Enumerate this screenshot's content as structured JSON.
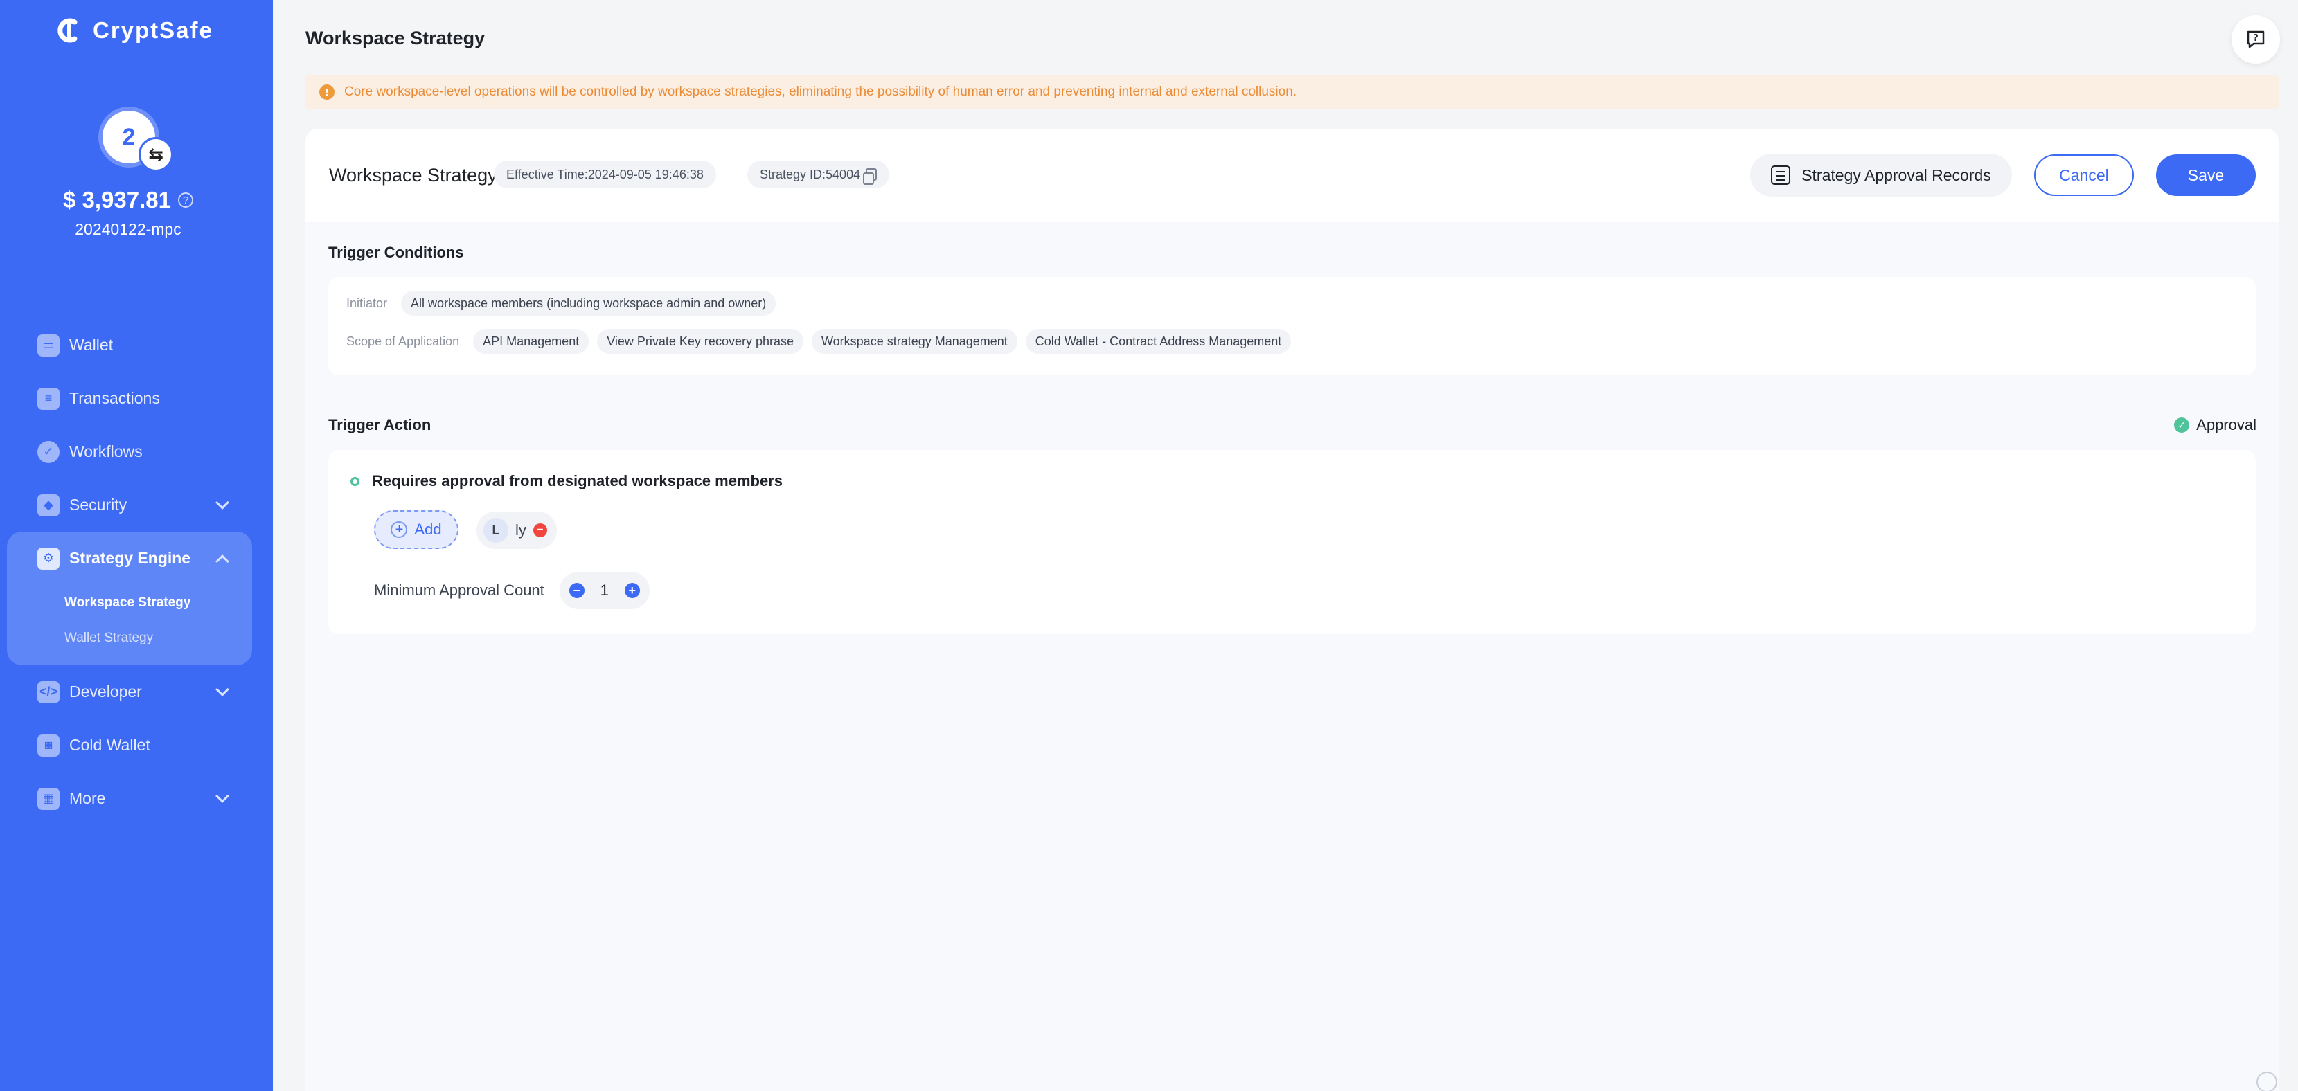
{
  "app": {
    "name": "CryptSafe"
  },
  "account": {
    "avatar_number": "2",
    "switch_glyph": "⇆",
    "balance": "$ 3,937.81",
    "wallet_name": "20240122-mpc"
  },
  "nav": {
    "wallet": "Wallet",
    "transactions": "Transactions",
    "workflows": "Workflows",
    "security": "Security",
    "strategy_engine": "Strategy Engine",
    "workspace_strategy": "Workspace Strategy",
    "wallet_strategy": "Wallet Strategy",
    "developer": "Developer",
    "cold_wallet": "Cold Wallet",
    "more": "More"
  },
  "header": {
    "title": "Workspace Strategy"
  },
  "notice": {
    "icon": "!",
    "text": "Core workspace-level operations will be controlled by workspace strategies, eliminating the possibility of human error and preventing internal and external collusion."
  },
  "strategy": {
    "title": "Workspace Strategy",
    "effective_time": "Effective Time:2024-09-05 19:46:38",
    "strategy_id": "Strategy ID:54004",
    "records_label": "Strategy Approval Records",
    "cancel_label": "Cancel",
    "save_label": "Save"
  },
  "trigger_conditions": {
    "title": "Trigger Conditions",
    "initiator_label": "Initiator",
    "initiator_value": "All workspace members (including workspace admin and owner)",
    "scope_label": "Scope of Application",
    "scope_items": [
      "API Management",
      "View Private Key recovery phrase",
      "Workspace strategy Management",
      "Cold Wallet - Contract Address Management"
    ]
  },
  "trigger_action": {
    "title": "Trigger Action",
    "status": "Approval",
    "requirement": "Requires approval from designated workspace members",
    "add_label": "Add",
    "member": {
      "initial": "L",
      "name": "ly"
    },
    "min_count_label": "Minimum Approval Count",
    "min_count": "1"
  }
}
